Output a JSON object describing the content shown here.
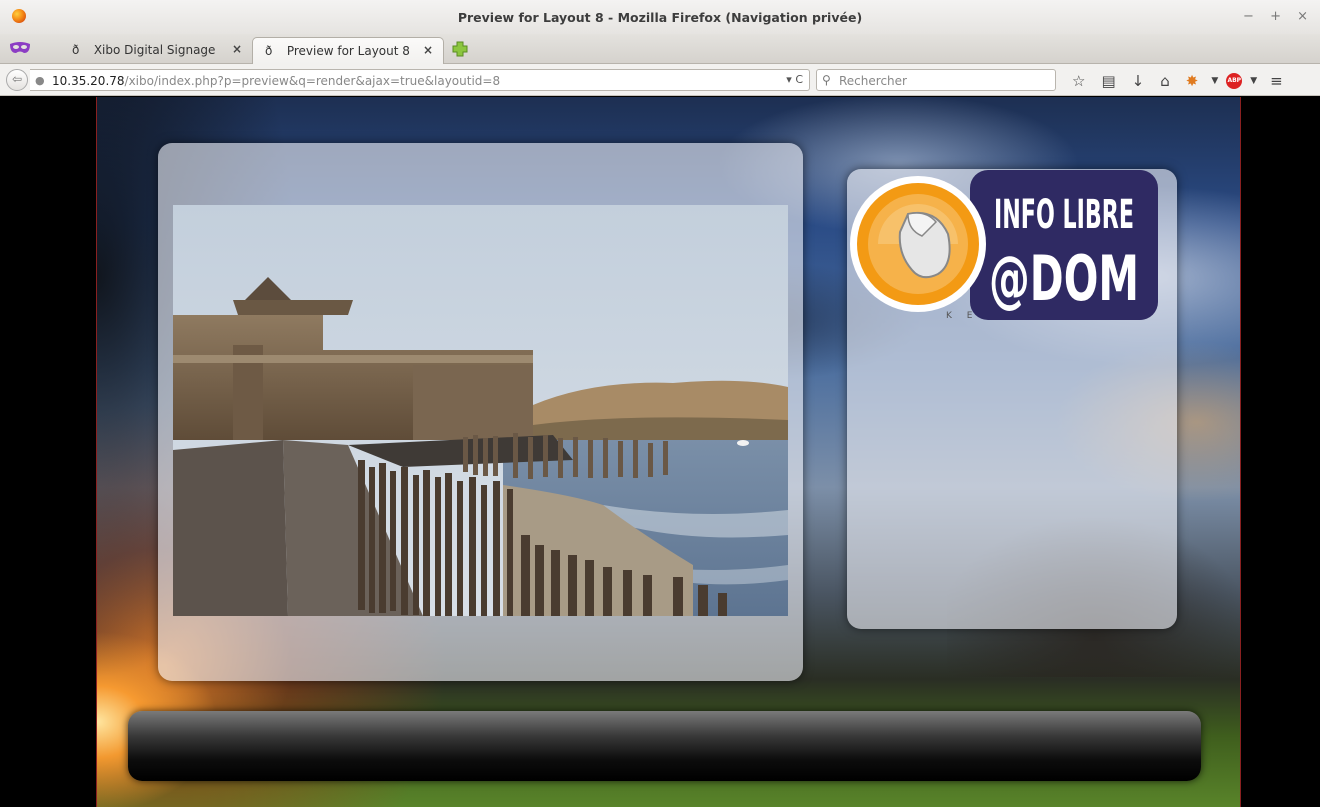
{
  "window": {
    "title": "Preview for Layout 8 - Mozilla Firefox (Navigation privée)",
    "controls": "− + ×"
  },
  "tabs": [
    {
      "label": "Xibo Digital Signage",
      "active": false,
      "icon": "xibo-favicon-icon"
    },
    {
      "label": "Preview for Layout 8",
      "active": true,
      "icon": "xibo-favicon-icon"
    }
  ],
  "navbar": {
    "url_host": "10.35.20.78",
    "url_path": "/xibo/index.php?p=preview&q=render&ajax=true&layoutid=8",
    "search_placeholder": "Rechercher",
    "icons": [
      "bookmark-star-icon",
      "reading-list-icon",
      "download-icon",
      "home-icon",
      "firebug-icon",
      "adblock-plus-icon",
      "menu-icon"
    ],
    "abp_label": "ABP"
  },
  "layout": {
    "logo_text_line1": "INFO LIBRE",
    "logo_text_line2": "@DOM",
    "logo_subtext": "K E",
    "colors": {
      "logo_bg": "#2f2a63",
      "logo_ring": "#f39a14"
    }
  }
}
